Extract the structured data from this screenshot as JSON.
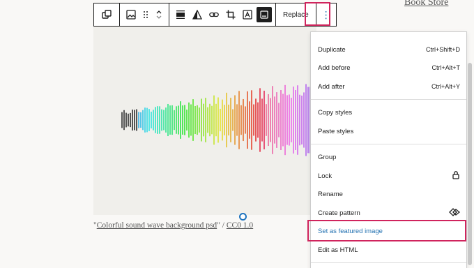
{
  "site": {
    "title": "Book Store"
  },
  "image": {
    "caption_quote_open": "\"",
    "caption_link_text": "Colorful sound wave background psd",
    "caption_quote_close": "\"",
    "caption_separator": " / ",
    "license_text": "CC0 1.0"
  },
  "toolbar": {
    "replace_label": "Replace",
    "more_label": "⋮",
    "icons": [
      "duplicate-block-icon",
      "image-block-icon",
      "drag-handle-icon",
      "move-up-icon",
      "move-down-icon",
      "align-icon",
      "duotone-icon",
      "link-icon",
      "crop-icon",
      "text-overlay-icon",
      "caption-icon"
    ]
  },
  "menu": {
    "items": [
      {
        "label": "Duplicate",
        "shortcut": "Ctrl+Shift+D"
      },
      {
        "label": "Add before",
        "shortcut": "Ctrl+Alt+T"
      },
      {
        "label": "Add after",
        "shortcut": "Ctrl+Alt+Y"
      },
      {
        "label": "Copy styles",
        "shortcut": ""
      },
      {
        "label": "Paste styles",
        "shortcut": ""
      },
      {
        "label": "Group",
        "shortcut": ""
      },
      {
        "label": "Lock",
        "shortcut": ""
      },
      {
        "label": "Rename",
        "shortcut": ""
      },
      {
        "label": "Create pattern",
        "shortcut": ""
      },
      {
        "label": "Set as featured image",
        "shortcut": ""
      },
      {
        "label": "Edit as HTML",
        "shortcut": ""
      }
    ]
  },
  "colors": {
    "highlight": "#d0245d",
    "accent": "#2271b1",
    "toolbar_border": "#1e1e1e"
  }
}
